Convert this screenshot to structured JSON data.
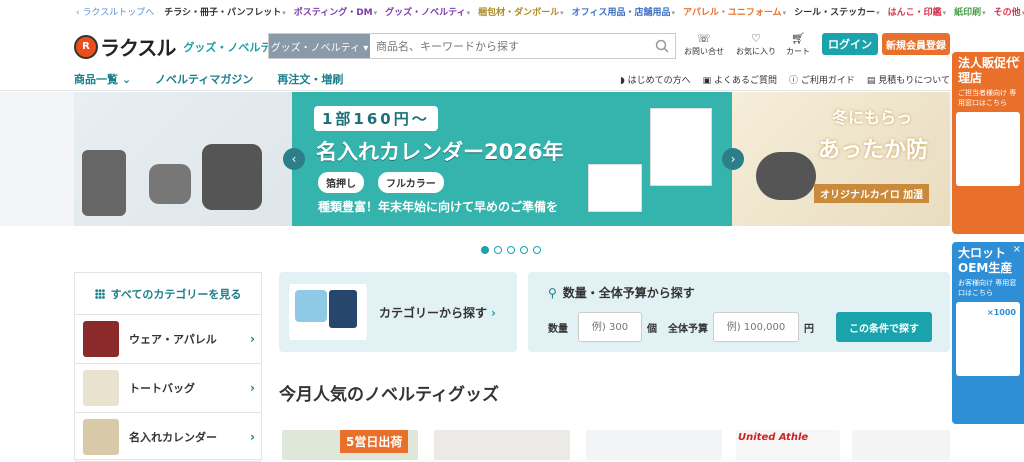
{
  "topbar": {
    "top_link": "ラクスルトップへ",
    "items": [
      {
        "label": "チラシ・冊子・パンフレット",
        "color": "#333333"
      },
      {
        "label": "ポスティング・DM",
        "color": "#7c3aa8"
      },
      {
        "label": "グッズ・ノベルティ",
        "color": "#7c3aa8"
      },
      {
        "label": "梱包材・ダンボール",
        "color": "#b08a1e"
      },
      {
        "label": "オフィス用品・店舗用品",
        "color": "#3a6fc4"
      },
      {
        "label": "アパレル・ユニフォーム",
        "color": "#e8702a"
      },
      {
        "label": "シール・ステッカー",
        "color": "#333333"
      },
      {
        "label": "はんこ・印鑑",
        "color": "#d9344c"
      },
      {
        "label": "紙印刷",
        "color": "#4aa04a"
      },
      {
        "label": "その他",
        "color": "#d9344c"
      }
    ]
  },
  "header": {
    "logo_mark": "R",
    "logo_text": "ラクスル",
    "logo_sub": "グッズ・ノベルティ",
    "search_category": "グッズ・ノベルティ ▾",
    "search_placeholder": "商品名、キーワードから探す",
    "contact": "お問い合せ",
    "favorite": "お気に入り",
    "cart": "カート",
    "login": "ログイン",
    "register": "新規会員登録"
  },
  "nav": {
    "left": [
      "商品一覧 ⌄",
      "ノベルティマガジン",
      "再注文・増刷"
    ],
    "right": [
      "はじめての方へ",
      "よくあるご質問",
      "ご利用ガイド",
      "見積もりについて"
    ]
  },
  "banner": {
    "head": "1部160円〜",
    "title": "名入れカレンダー2026年",
    "tag1": "箔押し",
    "tag2": "フルカラー",
    "sub": "種類豊富！年末年始に向けて早めのご準備を",
    "right_title1": "冬にもらっ",
    "right_title2": "あったか防",
    "right_tag": "オリジナルカイロ 加湿",
    "prev": "‹",
    "next": "›"
  },
  "categories": {
    "header": "すべてのカテゴリーを見る",
    "items": [
      "ウェア・アパレル",
      "トートバッグ",
      "名入れカレンダー"
    ]
  },
  "category_card": {
    "label": "カテゴリーから探す"
  },
  "quantity_card": {
    "title": "数量・全体予算から探す",
    "qty_label": "数量",
    "qty_placeholder": "例) 300",
    "qty_unit": "個",
    "budget_label": "全体予算",
    "budget_placeholder": "例) 100,000",
    "budget_unit": "円",
    "submit": "この条件で探す"
  },
  "section": {
    "title": "今月人気のノベルティグッズ",
    "badge": "5営日出荷",
    "brand": "United Athle"
  },
  "side_promos": [
    {
      "title": "法人販促代理店",
      "sub": "ご担当者様向け 専用窓口はこちら",
      "color": "#e8702a"
    },
    {
      "title": "大ロットOEM生産",
      "sub": "お客様向け 専用窓口はこちら",
      "color": "#2e8fd6"
    }
  ],
  "side_badge": "×1000"
}
